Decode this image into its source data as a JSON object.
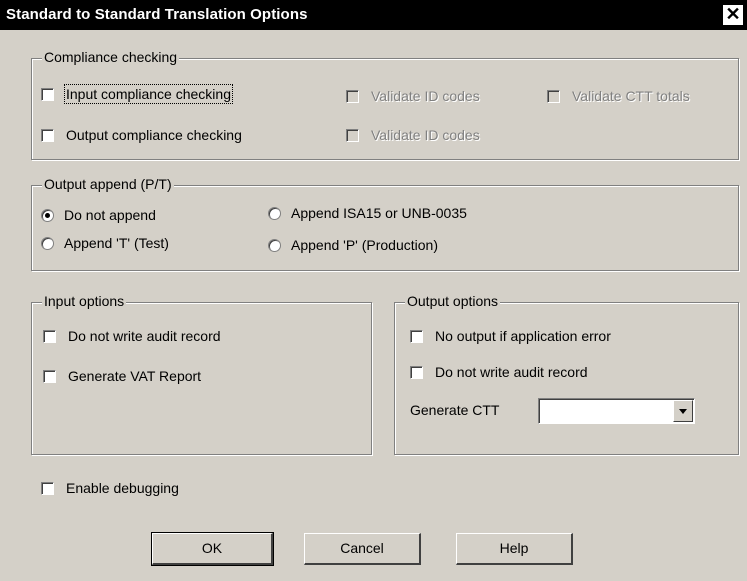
{
  "window": {
    "title": "Standard to Standard Translation Options",
    "close_symbol": "✕"
  },
  "compliance": {
    "legend": "Compliance checking",
    "input_label": "Input compliance checking",
    "output_label": "Output compliance checking",
    "validate_id_input": "Validate ID codes",
    "validate_ctt_input": "Validate CTT totals",
    "validate_id_output": "Validate ID codes"
  },
  "append": {
    "legend": "Output append (P/T)",
    "options": [
      {
        "label": "Do not append",
        "selected": true
      },
      {
        "label": "Append ISA15 or UNB-0035",
        "selected": false
      },
      {
        "label": "Append 'T' (Test)",
        "selected": false
      },
      {
        "label": "Append 'P' (Production)",
        "selected": false
      }
    ]
  },
  "input_options": {
    "legend": "Input options",
    "no_audit": "Do not write audit record",
    "vat_report": "Generate VAT Report"
  },
  "output_options": {
    "legend": "Output options",
    "no_output_error": "No output if application error",
    "no_audit": "Do not write audit record",
    "generate_ctt_label": "Generate CTT",
    "generate_ctt_value": ""
  },
  "debug": {
    "label": "Enable debugging"
  },
  "buttons": {
    "ok": "OK",
    "cancel": "Cancel",
    "help": "Help"
  }
}
